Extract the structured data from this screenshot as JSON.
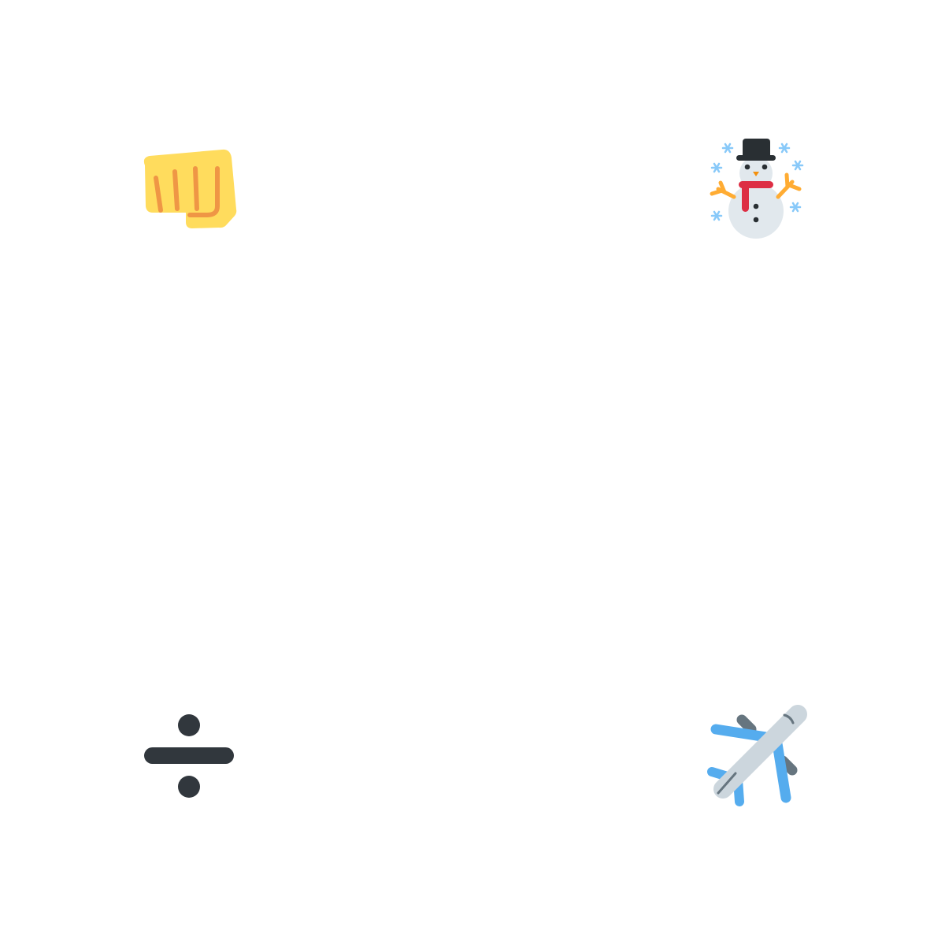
{
  "icons": [
    {
      "id": "fist",
      "name": "oncoming-fist-icon",
      "colors": {
        "skin": "#FFDC5D",
        "line": "#EF9645"
      }
    },
    {
      "id": "snowman",
      "name": "snowman-icon",
      "colors": {
        "body": "#E1E8ED",
        "hat": "#292F33",
        "scarf": "#DD2E44",
        "arms": "#FFAC33",
        "snowflakes": "#88C9F9",
        "nose": "#F4900C"
      }
    },
    {
      "id": "divide",
      "name": "division-sign-icon",
      "colors": {
        "glyph": "#31373D"
      }
    },
    {
      "id": "airplane",
      "name": "airplane-icon",
      "colors": {
        "fuselage": "#CCD6DD",
        "wings": "#55ACEE",
        "engines": "#66757F"
      }
    }
  ]
}
